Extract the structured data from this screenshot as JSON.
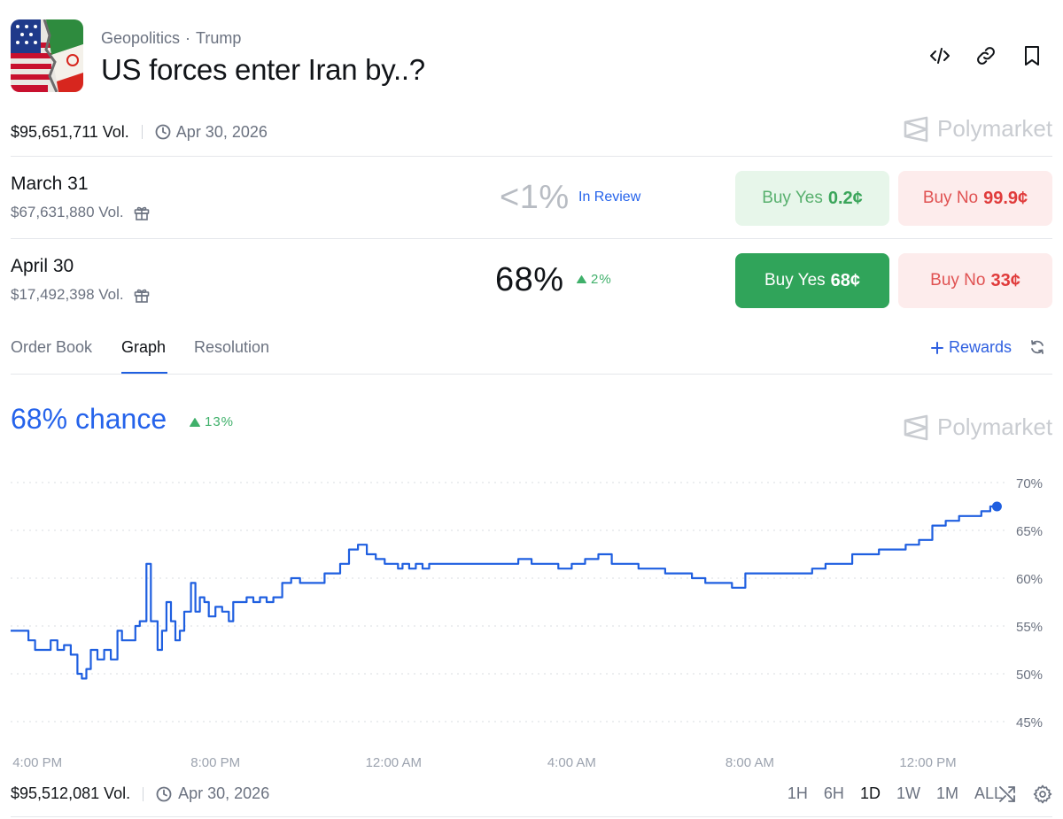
{
  "header": {
    "category": "Geopolitics",
    "tag": "Trump",
    "separator": "·",
    "title": "US forces enter Iran by..?"
  },
  "icons": [
    "embed-icon",
    "link-icon",
    "bookmark-icon",
    "clock-icon",
    "gift-icon",
    "refresh-icon",
    "shuffle-icon",
    "gear-icon",
    "polymarket-logo",
    "triangle-up-icon"
  ],
  "meta": {
    "volume": "$95,651,711 Vol.",
    "date": "Apr 30, 2026"
  },
  "brand": {
    "name": "Polymarket"
  },
  "markets": [
    {
      "name": "March 31",
      "volume": "$67,631,880 Vol.",
      "percent": "<1%",
      "status": "In Review",
      "buy_yes_label": "Buy Yes",
      "buy_yes_price": "0.2¢",
      "buy_no_label": "Buy No",
      "buy_no_price": "99.9¢"
    },
    {
      "name": "April 30",
      "volume": "$17,492,398 Vol.",
      "percent": "68%",
      "change": "2%",
      "buy_yes_label": "Buy Yes",
      "buy_yes_price": "68¢",
      "buy_no_label": "Buy No",
      "buy_no_price": "33¢"
    }
  ],
  "tabs": [
    {
      "label": "Order Book",
      "active": false
    },
    {
      "label": "Graph",
      "active": true
    },
    {
      "label": "Resolution",
      "active": false
    }
  ],
  "rewards_label": "Rewards",
  "chance": {
    "text": "68% chance",
    "change": "13%"
  },
  "colors": {
    "accent": "#2563eb",
    "up": "#3fb06a",
    "yes": "#30a45a",
    "no": "#e03b3b"
  },
  "chart_data": {
    "type": "line",
    "ylim": [
      45,
      70
    ],
    "y_ticks": [
      "70%",
      "65%",
      "60%",
      "55%",
      "50%",
      "45%"
    ],
    "x_ticks": [
      "4:00 PM",
      "8:00 PM",
      "12:00 AM",
      "4:00 AM",
      "8:00 AM",
      "12:00 PM"
    ],
    "x_tick_hours": [
      0,
      4,
      8,
      12,
      16,
      20
    ],
    "x_range_hours": [
      -0.6,
      21.8
    ],
    "series": [
      {
        "x": [
          -0.6,
          -0.35,
          -0.2,
          -0.05,
          0.1,
          0.3,
          0.45,
          0.6,
          0.75,
          0.9,
          1.0,
          1.1,
          1.2,
          1.35,
          1.5,
          1.65,
          1.8,
          1.9,
          2.05,
          2.2,
          2.3,
          2.45,
          2.55,
          2.7,
          2.8,
          2.9,
          3.0,
          3.1,
          3.2,
          3.3,
          3.45,
          3.55,
          3.65,
          3.75,
          3.85,
          4.0,
          4.15,
          4.3,
          4.4,
          4.55,
          4.7,
          4.85,
          5.0,
          5.15,
          5.3,
          5.5,
          5.7,
          5.9,
          6.2,
          6.45,
          6.6,
          6.8,
          7.0,
          7.2,
          7.4,
          7.6,
          7.8,
          8.0,
          8.1,
          8.2,
          8.35,
          8.5,
          8.65,
          8.8,
          9.0,
          9.3,
          9.6,
          9.9,
          10.2,
          10.5,
          10.8,
          11.1,
          11.4,
          11.7,
          12.0,
          12.3,
          12.6,
          12.9,
          13.2,
          13.5,
          13.8,
          14.1,
          14.4,
          14.7,
          15.0,
          15.3,
          15.6,
          15.9,
          16.2,
          16.5,
          16.8,
          17.1,
          17.4,
          17.7,
          18.0,
          18.3,
          18.6,
          18.9,
          19.2,
          19.5,
          19.8,
          20.1,
          20.4,
          20.7,
          21.0,
          21.2,
          21.4,
          21.55
        ],
        "y": [
          54.5,
          54.5,
          53.5,
          52.5,
          52.5,
          53.5,
          52.5,
          53.0,
          52.0,
          50.0,
          49.5,
          50.5,
          52.5,
          51.5,
          52.5,
          51.5,
          54.5,
          53.5,
          53.5,
          55.0,
          55.5,
          61.5,
          55.5,
          52.5,
          54.5,
          57.5,
          55.5,
          53.5,
          54.5,
          56.5,
          59.5,
          56.5,
          58.0,
          57.5,
          56.0,
          57.0,
          56.5,
          55.5,
          57.5,
          57.5,
          58.0,
          57.5,
          58.0,
          57.5,
          58.0,
          59.5,
          60.0,
          59.5,
          59.5,
          60.5,
          60.5,
          61.5,
          63.0,
          63.5,
          62.5,
          62.0,
          61.5,
          61.5,
          61.0,
          61.5,
          61.0,
          61.5,
          61.0,
          61.5,
          61.5,
          61.5,
          61.5,
          61.5,
          61.5,
          61.5,
          62.0,
          61.5,
          61.5,
          61.0,
          61.5,
          62.0,
          62.5,
          61.5,
          61.5,
          61.0,
          61.0,
          60.5,
          60.5,
          60.0,
          59.5,
          59.5,
          59.0,
          60.5,
          60.5,
          60.5,
          60.5,
          60.5,
          61.0,
          61.5,
          61.5,
          62.5,
          62.5,
          63.0,
          63.0,
          63.5,
          64.0,
          65.5,
          66.0,
          66.5,
          66.5,
          67.0,
          67.5,
          67.5
        ]
      }
    ]
  },
  "footer": {
    "volume": "$95,512,081 Vol.",
    "date": "Apr 30, 2026",
    "ranges": [
      "1H",
      "6H",
      "1D",
      "1W",
      "1M",
      "ALL"
    ],
    "active_range": "1D"
  }
}
